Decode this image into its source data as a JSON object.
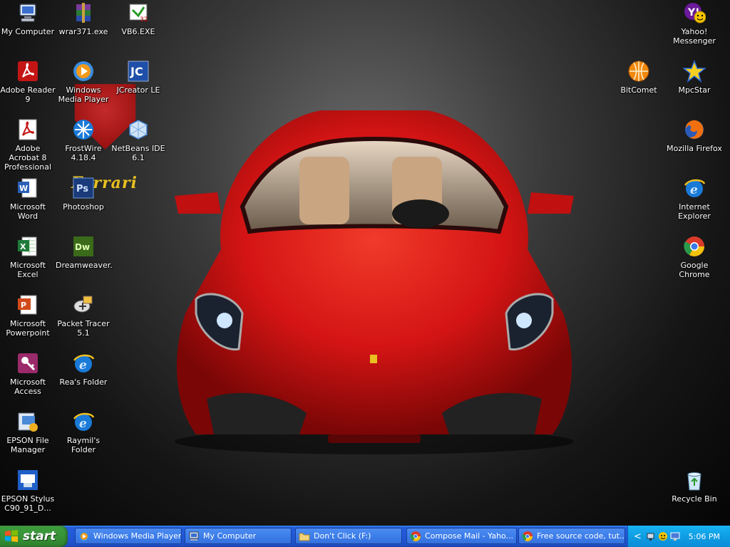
{
  "desktop": {
    "wallpaper_text": "Ferrari",
    "left_icons": [
      {
        "name": "my-computer",
        "label": "My Computer"
      },
      {
        "name": "wrar",
        "label": "wrar371.exe"
      },
      {
        "name": "vb6",
        "label": "VB6.EXE"
      },
      {
        "name": "adobe-reader",
        "label": "Adobe Reader 9"
      },
      {
        "name": "windows-media-player",
        "label": "Windows Media Player"
      },
      {
        "name": "jcreator",
        "label": "JCreator LE"
      },
      {
        "name": "adobe-acrobat",
        "label": "Adobe Acrobat 8 Professional"
      },
      {
        "name": "frostwire",
        "label": "FrostWire 4.18.4"
      },
      {
        "name": "netbeans",
        "label": "NetBeans IDE 6.1"
      },
      {
        "name": "microsoft-word",
        "label": "Microsoft Word"
      },
      {
        "name": "photoshop",
        "label": "Photoshop"
      },
      {
        "name": "microsoft-excel",
        "label": "Microsoft Excel"
      },
      {
        "name": "dreamweaver",
        "label": "Dreamweaver."
      },
      {
        "name": "microsoft-powerpoint",
        "label": "Microsoft Powerpoint"
      },
      {
        "name": "packet-tracer",
        "label": "Packet Tracer 5.1"
      },
      {
        "name": "microsoft-access",
        "label": "Microsoft Access"
      },
      {
        "name": "reas-folder",
        "label": "Rea's Folder"
      },
      {
        "name": "epson-file-manager",
        "label": "EPSON File Manager"
      },
      {
        "name": "raymils-folder",
        "label": "Raymil's Folder"
      },
      {
        "name": "epson-stylus",
        "label": "EPSON Stylus C90_91_D..."
      }
    ],
    "right_icons": [
      {
        "name": "yahoo-messenger",
        "label": "Yahoo! Messenger"
      },
      {
        "name": "bitcomet",
        "label": "BitComet"
      },
      {
        "name": "mpcstar",
        "label": "MpcStar"
      },
      {
        "name": "mozilla-firefox",
        "label": "Mozilla Firefox"
      },
      {
        "name": "internet-explorer",
        "label": "Internet Explorer"
      },
      {
        "name": "google-chrome",
        "label": "Google Chrome"
      },
      {
        "name": "recycle-bin",
        "label": "Recycle Bin"
      }
    ]
  },
  "taskbar": {
    "start_label": "start",
    "tasks": [
      {
        "name": "windows-media-player",
        "label": "Windows Media Player",
        "icon": "media-player-icon"
      },
      {
        "name": "my-computer",
        "label": "My Computer",
        "icon": "computer-icon"
      },
      {
        "name": "dont-click",
        "label": "Don't Click (F:)",
        "icon": "folder-icon"
      },
      {
        "name": "compose-mail",
        "label": "Compose Mail - Yaho...",
        "icon": "chrome-icon"
      },
      {
        "name": "free-source-code",
        "label": "Free source code, tut...",
        "icon": "chrome-icon"
      }
    ],
    "tray": {
      "expand_glyph": "<",
      "clock": "5:06 PM"
    }
  },
  "colors": {
    "taskbar_blue": "#245edb",
    "start_green": "#3c9a3c",
    "tray_blue": "#0f9de3",
    "car_red": "#d41414"
  }
}
